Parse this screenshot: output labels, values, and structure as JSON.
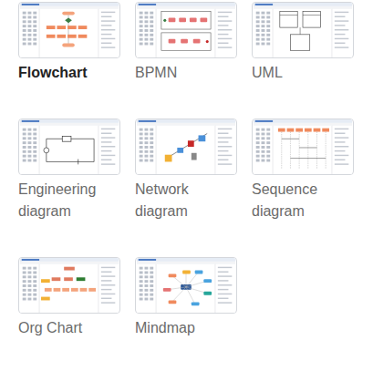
{
  "templates": [
    {
      "label": "Flowchart",
      "selected": true,
      "kind": "flowchart"
    },
    {
      "label": "BPMN",
      "selected": false,
      "kind": "bpmn"
    },
    {
      "label": "UML",
      "selected": false,
      "kind": "uml"
    },
    {
      "label": "Engineering diagram",
      "selected": false,
      "kind": "engineering"
    },
    {
      "label": "Network diagram",
      "selected": false,
      "kind": "network"
    },
    {
      "label": "Sequence diagram",
      "selected": false,
      "kind": "sequence"
    },
    {
      "label": "Org Chart",
      "selected": false,
      "kind": "org"
    },
    {
      "label": "Mindmap",
      "selected": false,
      "kind": "mindmap"
    }
  ]
}
